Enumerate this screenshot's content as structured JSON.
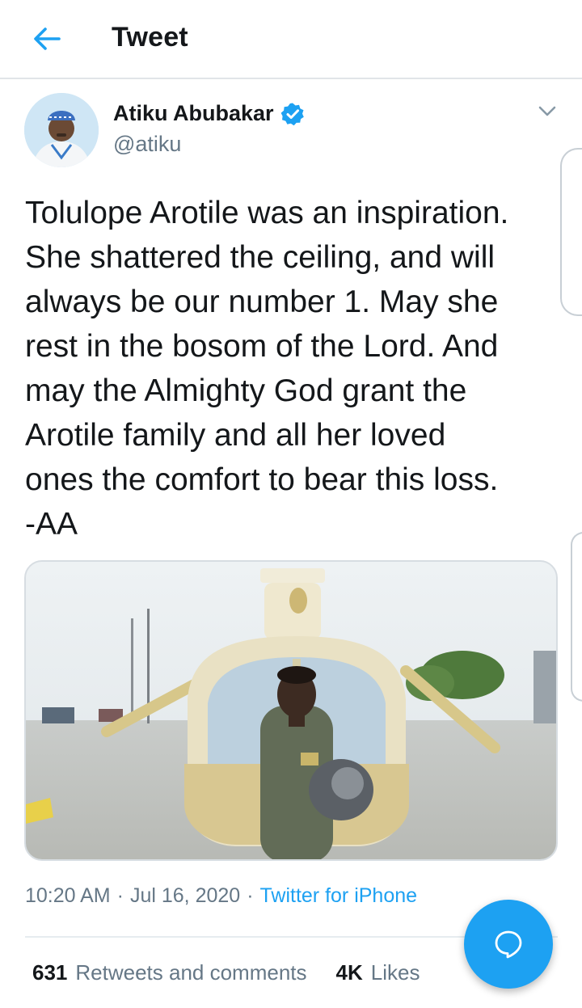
{
  "header": {
    "title": "Tweet",
    "back_icon": "arrow-left-icon"
  },
  "author": {
    "name": "Atiku Abubakar",
    "handle": "@atiku",
    "verified": true
  },
  "tweet": {
    "text": "Tolulope Arotile was an inspiration.\nShe shattered the ceiling, and will\nalways be our number 1. May she\nrest in the bosom of the Lord. And\nmay the Almighty God grant the\nArotile family and all her loved\nones the comfort to bear this loss.\n-AA"
  },
  "meta": {
    "time": "10:20 AM",
    "separator": "·",
    "date": "Jul 16, 2020",
    "source": "Twitter for iPhone"
  },
  "stats": {
    "retweets_count": "631",
    "retweets_label": "Retweets and comments",
    "likes_count": "4K",
    "likes_label": "Likes"
  },
  "colors": {
    "accent": "#1da1f2",
    "secondary_text": "#657786",
    "primary_text": "#14171a"
  },
  "icons": {
    "more": "chevron-down-icon",
    "verified": "verified-badge-icon",
    "fab": "compose-reply-icon"
  }
}
